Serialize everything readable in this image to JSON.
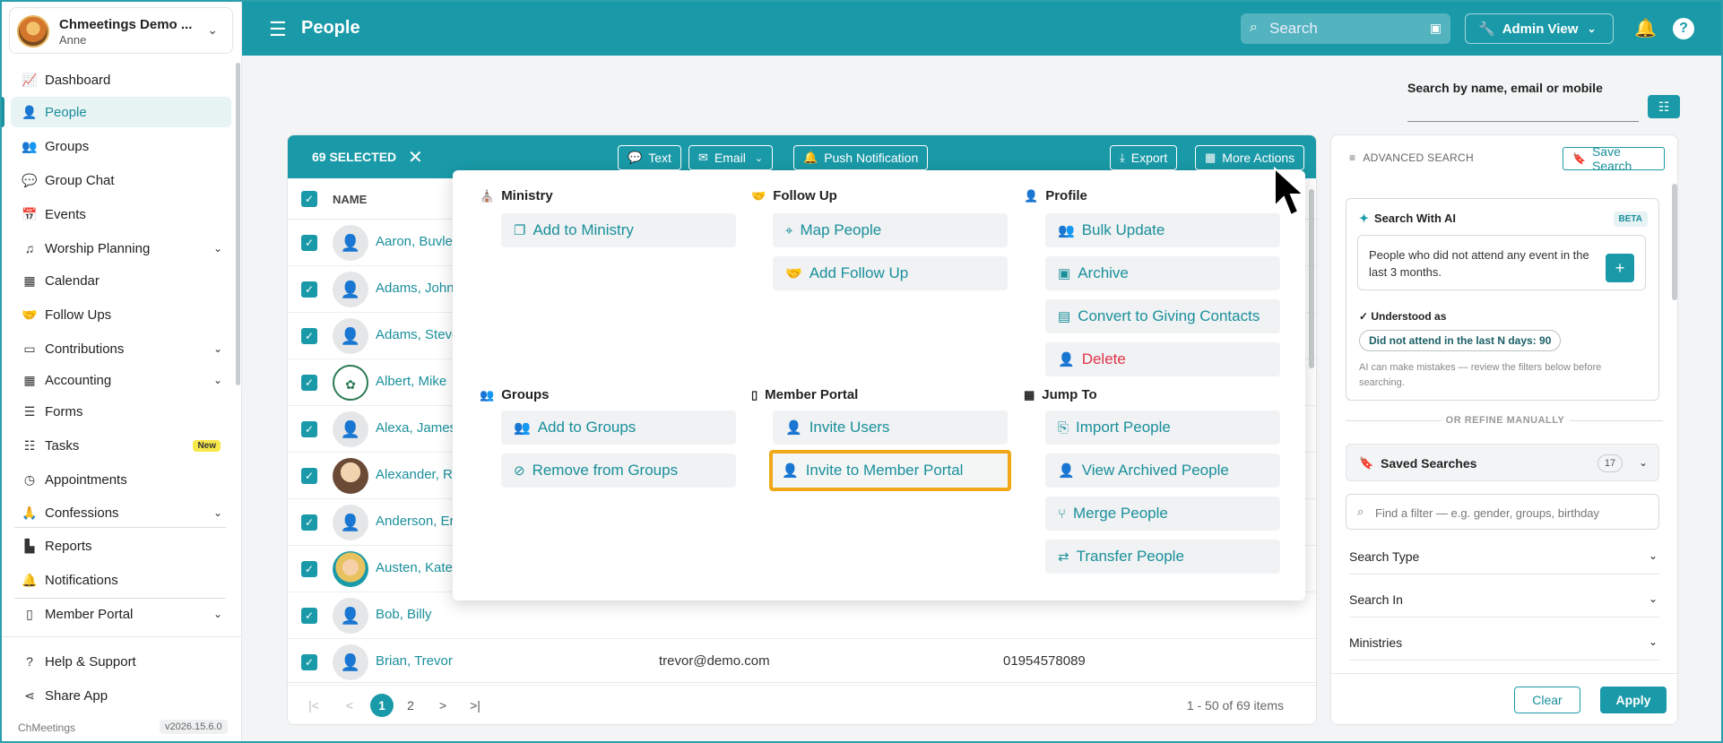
{
  "sidebar": {
    "org_name": "Chmeetings Demo ...",
    "org_user": "Anne",
    "items": [
      {
        "label": "Dashboard",
        "icon": "chart-line-icon"
      },
      {
        "label": "People",
        "icon": "person-icon"
      },
      {
        "label": "Groups",
        "icon": "users-icon"
      },
      {
        "label": "Group Chat",
        "icon": "chat-icon"
      },
      {
        "label": "Events",
        "icon": "calendar-check-icon"
      },
      {
        "label": "Worship Planning",
        "icon": "music-icon"
      },
      {
        "label": "Calendar",
        "icon": "calendar-icon"
      },
      {
        "label": "Follow Ups",
        "icon": "handshake-icon"
      },
      {
        "label": "Contributions",
        "icon": "money-icon"
      },
      {
        "label": "Accounting",
        "icon": "grid-icon"
      },
      {
        "label": "Forms",
        "icon": "form-icon"
      },
      {
        "label": "Tasks",
        "icon": "list-check-icon"
      },
      {
        "label": "Appointments",
        "icon": "clock-icon"
      },
      {
        "label": "Confessions",
        "icon": "praying-icon"
      },
      {
        "label": "Reports",
        "icon": "bar-chart-icon"
      },
      {
        "label": "Notifications",
        "icon": "bell-icon"
      },
      {
        "label": "Member Portal",
        "icon": "mobile-icon"
      },
      {
        "label": "Help & Support",
        "icon": "question-icon"
      },
      {
        "label": "Share App",
        "icon": "share-icon"
      }
    ],
    "tasks_badge": "New",
    "footer_label": "ChMeetings",
    "version": "v2026.15.6.0"
  },
  "topbar": {
    "title": "People",
    "search_placeholder": "Search",
    "admin_view": "Admin View"
  },
  "search_header": {
    "label": "Search by name, email or mobile"
  },
  "selection": {
    "count_label": "69 SELECTED",
    "buttons": {
      "text": "Text",
      "email": "Email",
      "push": "Push Notification",
      "export": "Export",
      "more": "More Actions"
    }
  },
  "table": {
    "header_name": "NAME",
    "rows": [
      {
        "name": "Aaron, Buvle",
        "email": "",
        "phone": ""
      },
      {
        "name": "Adams, John",
        "email": "",
        "phone": ""
      },
      {
        "name": "Adams, Steve",
        "email": "",
        "phone": ""
      },
      {
        "name": "Albert, Mike",
        "email": "",
        "phone": ""
      },
      {
        "name": "Alexa, James",
        "email": "",
        "phone": ""
      },
      {
        "name": "Alexander, Ra",
        "email": "",
        "phone": ""
      },
      {
        "name": "Anderson, Er",
        "email": "",
        "phone": ""
      },
      {
        "name": "Austen, Kate",
        "email": "",
        "phone": ""
      },
      {
        "name": "Bob, Billy",
        "email": "",
        "phone": ""
      },
      {
        "name": "Brian, Trevor",
        "email": "trevor@demo.com",
        "phone": "01954578089"
      }
    ],
    "pages": [
      "1",
      "2"
    ],
    "current_page": 1,
    "items_info": "1 - 50 of 69 items"
  },
  "more_actions": {
    "ministry": {
      "title": "Ministry",
      "items": [
        "Add to Ministry"
      ]
    },
    "follow_up": {
      "title": "Follow Up",
      "items": [
        "Map People",
        "Add Follow Up"
      ]
    },
    "profile": {
      "title": "Profile",
      "items": [
        "Bulk Update",
        "Archive",
        "Convert to Giving Contacts",
        "Delete"
      ]
    },
    "groups": {
      "title": "Groups",
      "items": [
        "Add to Groups",
        "Remove from Groups"
      ]
    },
    "member_portal": {
      "title": "Member Portal",
      "items": [
        "Invite Users",
        "Invite to Member Portal"
      ]
    },
    "jump_to": {
      "title": "Jump To",
      "items": [
        "Import People",
        "View Archived People",
        "Merge People",
        "Transfer People"
      ]
    }
  },
  "advanced_search": {
    "title": "ADVANCED SEARCH",
    "save_search": "Save Search",
    "ai_title": "Search With AI",
    "beta": "BETA",
    "ai_query": "People who did not attend any event in the last 3 months.",
    "understood_label": "Understood as",
    "understood_chip": "Did not attend in the last N days: 90",
    "ai_note": "AI can make mistakes — review the filters below before searching.",
    "or_refine": "OR REFINE MANUALLY",
    "saved_searches": "Saved Searches",
    "saved_count": "17",
    "filter_placeholder": "Find a filter — e.g. gender, groups, birthday",
    "accordions": [
      "Search Type",
      "Search In",
      "Ministries"
    ],
    "clear": "Clear",
    "apply": "Apply"
  },
  "colors": {
    "brand": "#1a9aa8",
    "danger": "#e0334a",
    "focus_outline": "#f0a818"
  }
}
